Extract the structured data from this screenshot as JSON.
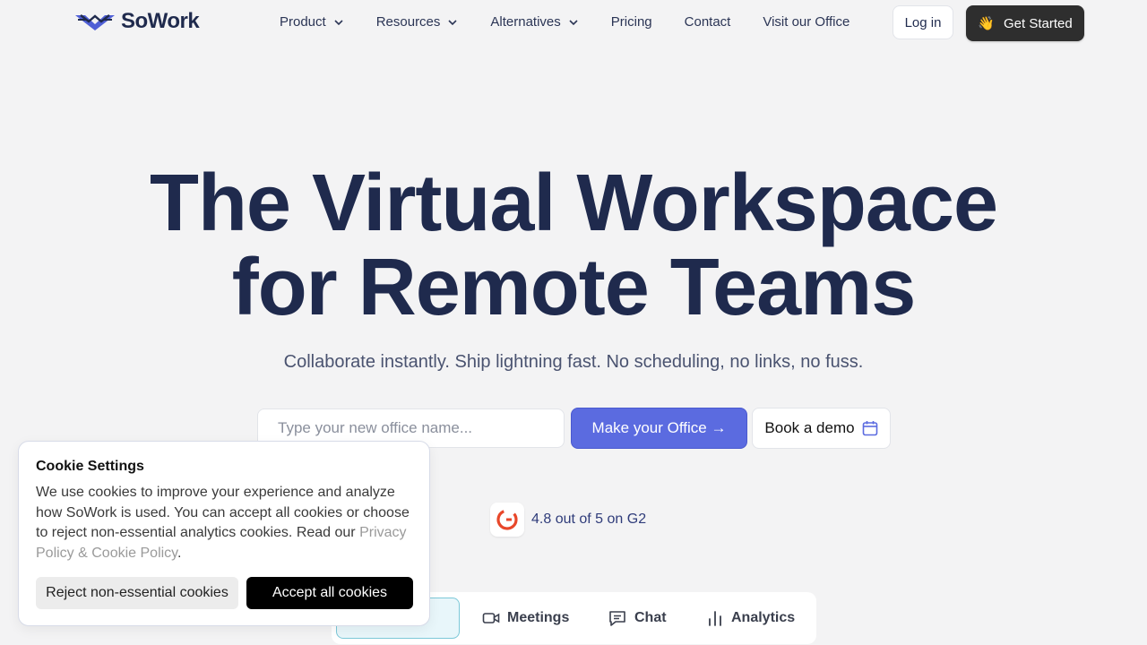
{
  "header": {
    "logo_text": "SoWork",
    "nav": [
      {
        "label": "Product",
        "has_dropdown": true
      },
      {
        "label": "Resources",
        "has_dropdown": true
      },
      {
        "label": "Alternatives",
        "has_dropdown": true
      },
      {
        "label": "Pricing",
        "has_dropdown": false
      },
      {
        "label": "Contact",
        "has_dropdown": false
      },
      {
        "label": "Visit our Office",
        "has_dropdown": false
      }
    ],
    "login_label": "Log in",
    "get_started_label": "Get Started"
  },
  "hero": {
    "title_line1": "The Virtual Workspace",
    "title_line2": "for Remote Teams",
    "subtitle": "Collaborate instantly. Ship lightning fast. No scheduling, no links, no fuss.",
    "office_input_placeholder": "Type your new office name...",
    "office_input_value": "",
    "make_office_label": "Make your Office →",
    "book_demo_label": "Book a demo",
    "rating_text": "4.8 out of 5 on G2"
  },
  "tabs": [
    {
      "label": "ce",
      "icon": "office-icon",
      "active": true
    },
    {
      "label": "Meetings",
      "icon": "video-icon",
      "active": false
    },
    {
      "label": "Chat",
      "icon": "chat-icon",
      "active": false
    },
    {
      "label": "Analytics",
      "icon": "analytics-icon",
      "active": false
    }
  ],
  "cookie": {
    "title": "Cookie Settings",
    "body": "We use cookies to improve your experience and analyze how SoWork is used. You can accept all cookies or choose to reject non-essential analytics cookies. Read our ",
    "link_text": "Privacy Policy & Cookie Policy",
    "body_end": ".",
    "reject_label": "Reject non-essential cookies",
    "accept_label": "Accept all cookies"
  },
  "colors": {
    "primary": "#5b6be0",
    "navy": "#1f2a4d",
    "dark_button": "#2e2e2e",
    "background": "#f3f3f4",
    "g2_red": "#e8472a"
  }
}
